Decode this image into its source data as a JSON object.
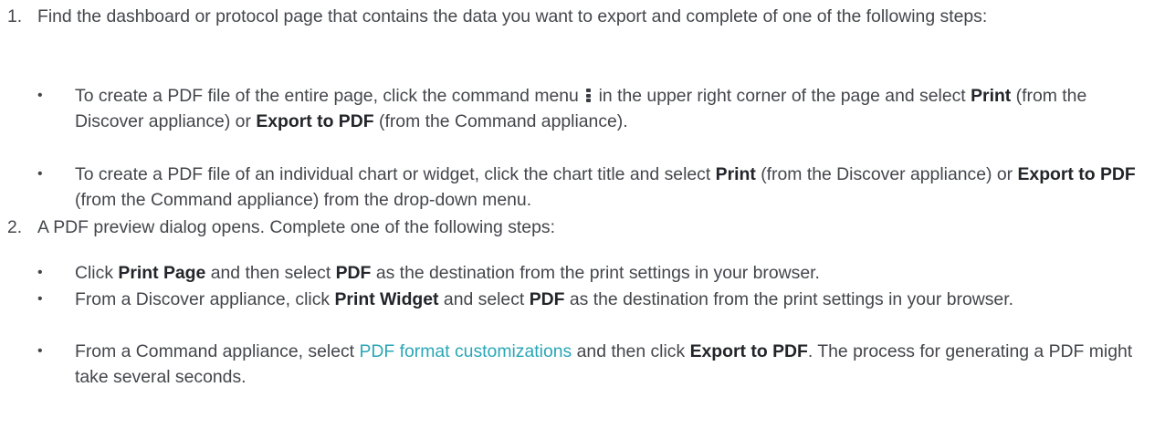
{
  "steps": [
    {
      "number": "1.",
      "text": "Find the dashboard or protocol page that contains the data you want to export and complete of one of the following steps:",
      "bullets": [
        {
          "a": "To create a PDF file of the entire page, click the command menu",
          "icon": "kebab-menu-icon",
          "b": "in the upper right corner of the page and select",
          "bold1": "Print",
          "c": "(from the Discover appliance) or",
          "bold2": "Export to PDF",
          "d": "(from the Command appliance)."
        },
        {
          "a": "To create a PDF file of an individual chart or widget, click the chart title and select",
          "bold1": "Print",
          "b": "(from the Discover appliance) or",
          "bold2": "Export to PDF",
          "c": "(from the Command appliance) from the drop-down menu."
        }
      ]
    },
    {
      "number": "2.",
      "text": "A PDF preview dialog opens. Complete one of the following steps:",
      "bullets": [
        {
          "a": "Click",
          "bold1": "Print Page",
          "b": "and then select",
          "bold2": "PDF",
          "c": "as the destination from the print settings in your browser."
        },
        {
          "a": "From a Discover appliance, click",
          "bold1": "Print Widget",
          "b": "and select",
          "bold2": "PDF",
          "c": "as the destination from the print settings in your browser."
        },
        {
          "a": "From a Command appliance, select",
          "link": "PDF format customizations",
          "b": "and then click",
          "bold1": "Export to PDF",
          "c": ". The process for generating a PDF might take several seconds."
        }
      ]
    }
  ],
  "bullet_glyph": "•",
  "colors": {
    "text": "#44464c",
    "bold": "#23252a",
    "link": "#2aa6b6"
  }
}
